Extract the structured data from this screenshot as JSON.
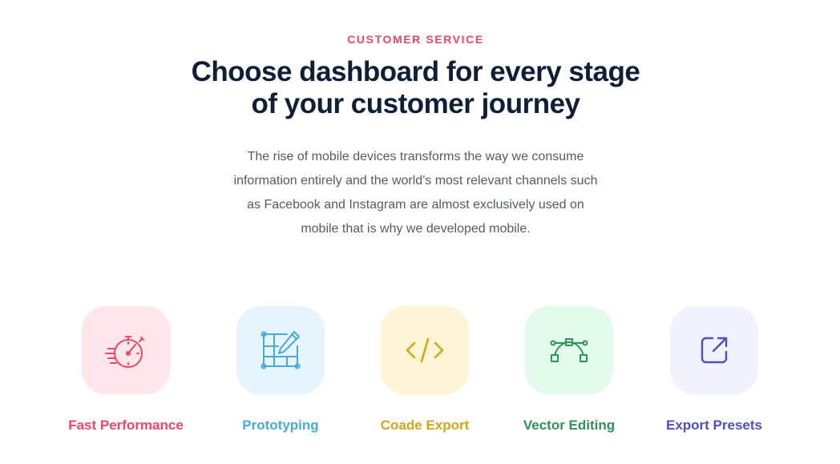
{
  "section": {
    "eyebrow": "CUSTOMER SERVICE",
    "headline": {
      "line1": "Choose dashboard for every stage",
      "line2": "of your customer journey"
    },
    "intro": {
      "line1": "The rise of mobile devices transforms the way we consume",
      "line2": "information entirely and the world's most relevant channels such",
      "line3": "as Facebook and Instagram are almost exclusively used on",
      "line4": "mobile that is why we developed mobile."
    }
  },
  "features": [
    {
      "label": "Fast Performance",
      "icon": "stopwatch-icon",
      "color": "#ef4567",
      "tile_bg": "#ffe6ea"
    },
    {
      "label": "Prototyping",
      "icon": "prototype-pen-icon",
      "color": "#45acd9",
      "tile_bg": "#e6f5fd"
    },
    {
      "label": "Coade Export",
      "icon": "code-icon",
      "color": "#d6a514",
      "tile_bg": "#fff5d6"
    },
    {
      "label": "Vector Editing",
      "icon": "vector-curve-icon",
      "color": "#2e9357",
      "tile_bg": "#e3fbeb"
    },
    {
      "label": "Export Presets",
      "icon": "external-link-icon",
      "color": "#4c4fc9",
      "tile_bg": "#f1f2fe"
    }
  ],
  "colors": {
    "accent": "#ef4567",
    "heading": "#0f1f38",
    "body_text": "#555a66"
  }
}
